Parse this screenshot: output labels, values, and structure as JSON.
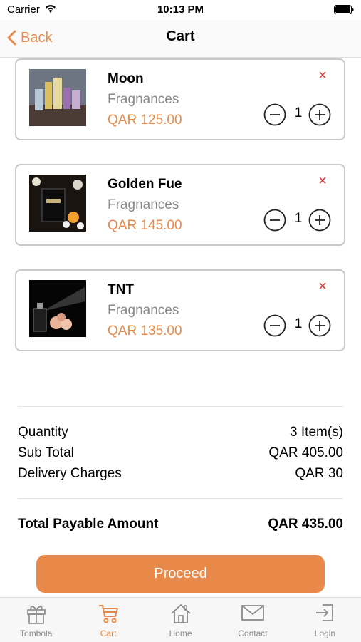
{
  "status": {
    "carrier": "Carrier",
    "time": "10:13 PM"
  },
  "nav": {
    "back_label": "Back",
    "title": "Cart"
  },
  "colors": {
    "accent": "#e8894a",
    "remove": "#e03030",
    "muted": "#8a8a8a"
  },
  "cart": {
    "items": [
      {
        "name": "Moon",
        "category": "Fragnances",
        "price": "QAR 125.00",
        "quantity": "1"
      },
      {
        "name": "Golden Fue",
        "category": "Fragnances",
        "price": "QAR 145.00",
        "quantity": "1"
      },
      {
        "name": "TNT",
        "category": "Fragnances",
        "price": "QAR 135.00",
        "quantity": "1"
      }
    ],
    "remove_glyph": "×"
  },
  "summary": {
    "quantity_label": "Quantity",
    "quantity_value": "3 Item(s)",
    "subtotal_label": "Sub Total",
    "subtotal_value": "QAR 405.00",
    "delivery_label": "Delivery Charges",
    "delivery_value": "QAR 30",
    "total_label": "Total Payable Amount",
    "total_value": "QAR 435.00"
  },
  "proceed_label": "Proceed",
  "tabs": [
    {
      "label": "Tombola",
      "icon": "gift-icon"
    },
    {
      "label": "Cart",
      "icon": "cart-icon",
      "active": true
    },
    {
      "label": "Home",
      "icon": "home-icon"
    },
    {
      "label": "Contact",
      "icon": "mail-icon"
    },
    {
      "label": "Login",
      "icon": "login-icon"
    }
  ]
}
